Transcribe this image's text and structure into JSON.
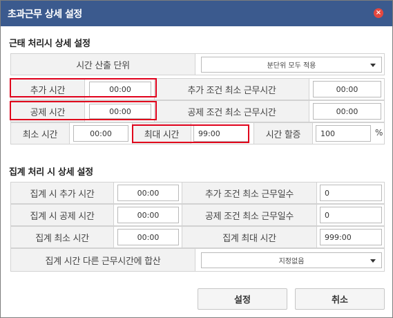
{
  "dialog": {
    "title": "초과근무 상세 설정",
    "close_icon": "×"
  },
  "detail": {
    "section_title": "근태 처리시 상세 설정",
    "time_unit_label": "시간 산출 단위",
    "time_unit_value": "분단위 모두 적용",
    "add_time_label": "추가 시간",
    "add_time_value": "00:00",
    "add_min_label": "추가 조건 최소 근무시간",
    "add_min_value": "00:00",
    "deduct_time_label": "공제 시간",
    "deduct_time_value": "00:00",
    "deduct_min_label": "공제 조건 최소 근무시간",
    "deduct_min_value": "00:00",
    "min_time_label": "최소 시간",
    "min_time_value": "00:00",
    "max_time_label": "최대 시간",
    "max_time_value": "99:00",
    "premium_label": "시간 할증",
    "premium_value": "100",
    "premium_unit": "%"
  },
  "summary": {
    "section_title": "집계 처리 시 상세 설정",
    "add_time_label": "집계 시 추가 시간",
    "add_time_value": "00:00",
    "add_min_days_label": "추가 조건 최소 근무일수",
    "add_min_days_value": "0",
    "deduct_time_label": "집계 시 공제 시간",
    "deduct_time_value": "00:00",
    "deduct_min_days_label": "공제 조건 최소 근무일수",
    "deduct_min_days_value": "0",
    "min_time_label": "집계 최소 시간",
    "min_time_value": "00:00",
    "max_time_label": "집계 최대 시간",
    "max_time_value": "999:00",
    "merge_label": "집계 시간 다른 근무시간에 합산",
    "merge_value": "지정없음"
  },
  "buttons": {
    "confirm": "설정",
    "cancel": "취소"
  },
  "colors": {
    "titlebar": "#3b5a8e",
    "close": "#e5483f",
    "highlight": "#e0001b"
  }
}
